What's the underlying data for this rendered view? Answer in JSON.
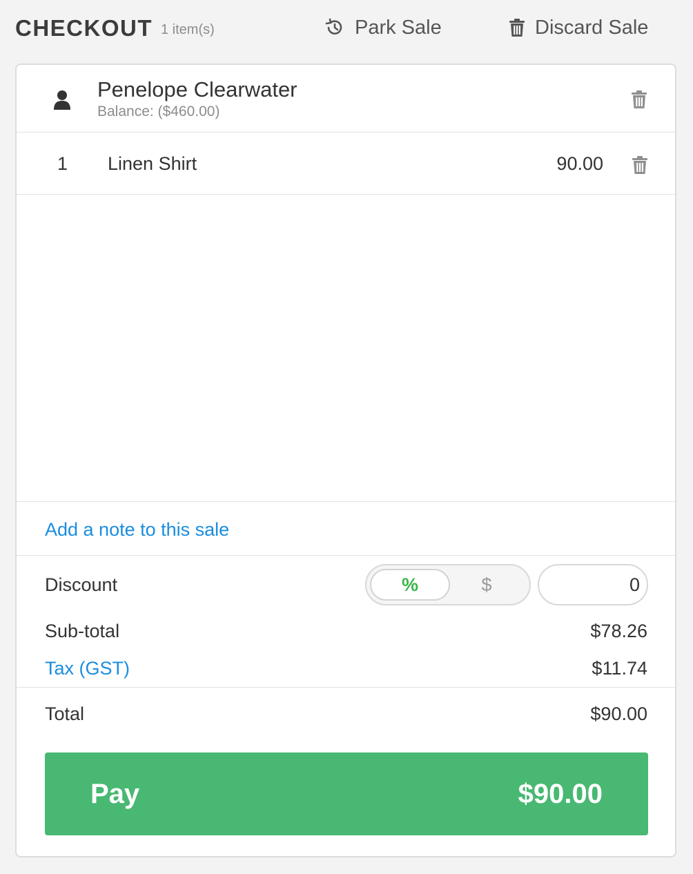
{
  "header": {
    "title": "CHECKOUT",
    "item_count": "1 item(s)",
    "park_label": "Park Sale",
    "discard_label": "Discard Sale"
  },
  "customer": {
    "name": "Penelope Clearwater",
    "balance": "Balance: ($460.00)"
  },
  "line_items": [
    {
      "qty": "1",
      "name": "Linen Shirt",
      "price": "90.00"
    }
  ],
  "note": {
    "link": "Add a note to this sale"
  },
  "discount": {
    "label": "Discount",
    "percent_option": "%",
    "dollar_option": "$",
    "selected": "%",
    "value": "0"
  },
  "totals": {
    "subtotal_label": "Sub-total",
    "subtotal_value": "$78.26",
    "tax_label": "Tax (GST)",
    "tax_value": "$11.74",
    "total_label": "Total",
    "total_value": "$90.00"
  },
  "pay": {
    "label": "Pay",
    "amount": "$90.00"
  },
  "colors": {
    "accent_green": "#48b872",
    "link_blue": "#1a8ddf",
    "toggle_active": "#3ab54a"
  },
  "icons": {
    "park": "history-icon",
    "discard": "trash-icon",
    "customer": "user-icon",
    "remove_customer": "trash-icon",
    "remove_line": "trash-icon"
  }
}
